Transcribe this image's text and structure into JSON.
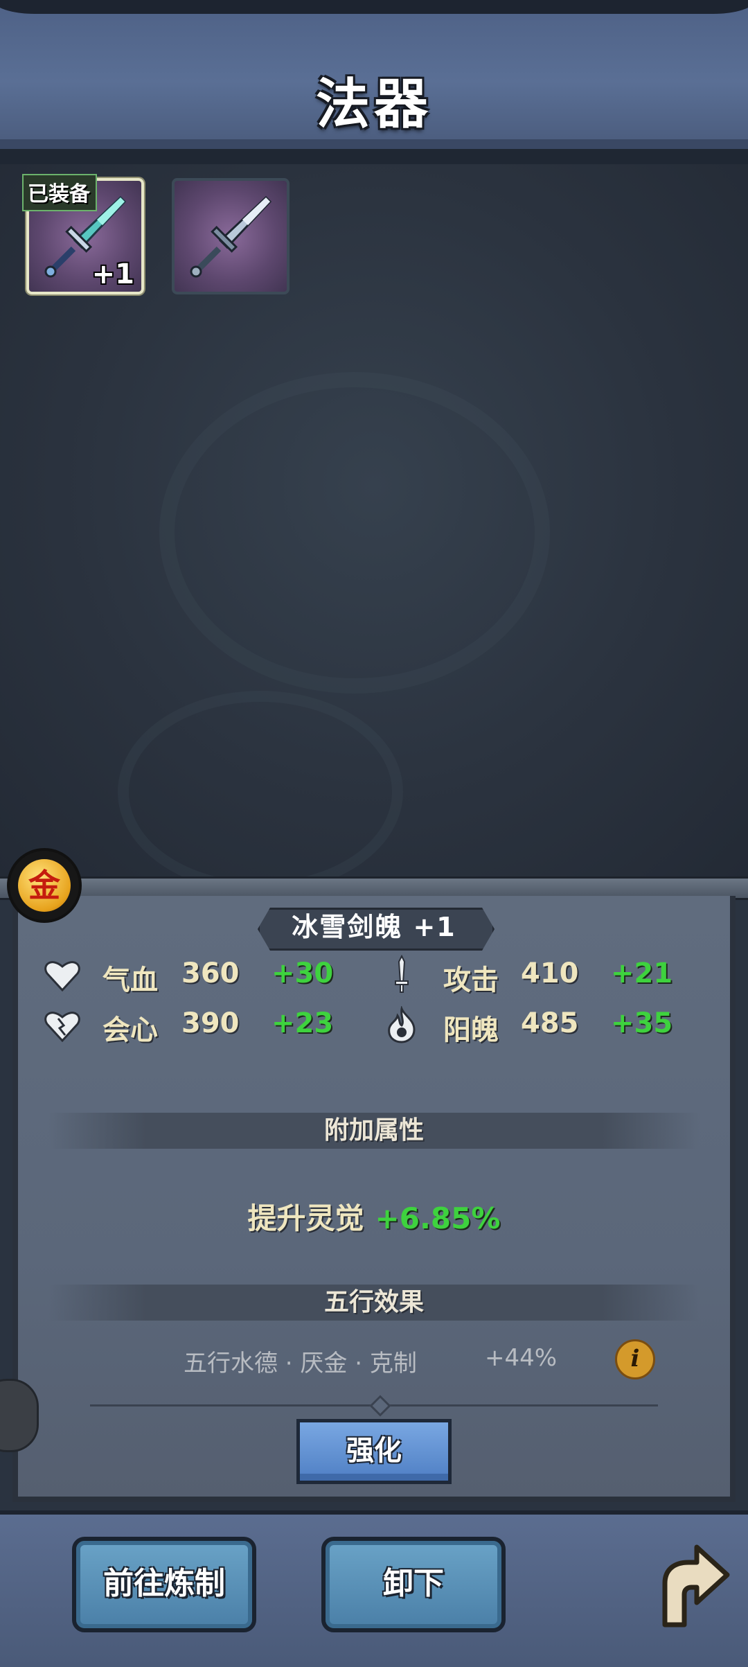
{
  "header": {
    "title": "法器"
  },
  "inventory": {
    "slots": [
      {
        "tag": "已装备",
        "level_badge": "+1",
        "equipped": true
      },
      {
        "tag": "",
        "level_badge": "",
        "equipped": false
      }
    ]
  },
  "detail": {
    "element_badge": "金",
    "item_name": "冰雪剑魄 +1",
    "stats": [
      {
        "icon": "heart-icon",
        "label": "气血",
        "value": "360",
        "bonus": "+30"
      },
      {
        "icon": "sword-icon",
        "label": "攻击",
        "value": "410",
        "bonus": "+21"
      },
      {
        "icon": "crit-heart-icon",
        "label": "会心",
        "value": "390",
        "bonus": "+23"
      },
      {
        "icon": "soul-flame-icon",
        "label": "阳魄",
        "value": "485",
        "bonus": "+35"
      }
    ],
    "extra_section_title": "附加属性",
    "extra_bonus": {
      "label": "提升灵觉",
      "value": "+6.85%"
    },
    "wuxing_section_title": "五行效果",
    "wuxing_effect": {
      "label": "五行水德 · 厌金 · 克制",
      "value": "+44%"
    },
    "enhance_label": "强化"
  },
  "bottom": {
    "refine_label": "前往炼制",
    "unequip_label": "卸下"
  },
  "colors": {
    "bonus_green": "#3ed23e",
    "stat_text": "#efe6bf",
    "header_blue": "#5a6f95",
    "button_blue": "#4f7fc4"
  }
}
